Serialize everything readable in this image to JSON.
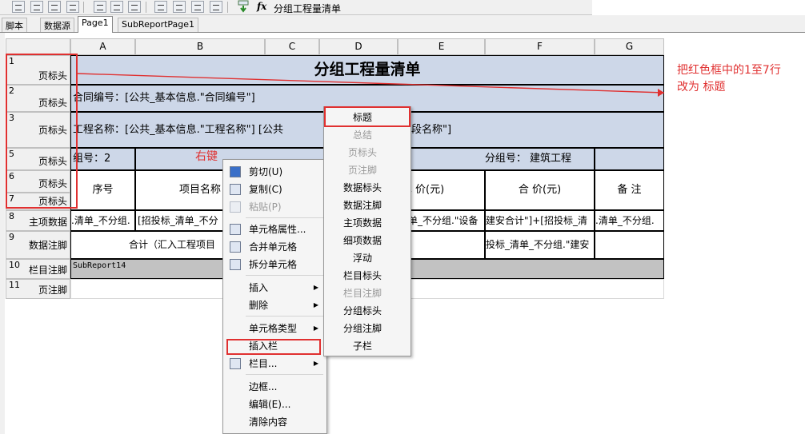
{
  "toolbar": {
    "formula_text": "分组工程量清单"
  },
  "tabs": [
    "脚本",
    "数据源",
    "Page1",
    "SubReportPage1"
  ],
  "columns": [
    "A",
    "B",
    "C",
    "D",
    "E",
    "F",
    "G"
  ],
  "rows": [
    {
      "num": "1",
      "label": "页标头"
    },
    {
      "num": "2",
      "label": "页标头"
    },
    {
      "num": "3",
      "label": "页标头"
    },
    {
      "num": "5",
      "label": "页标头"
    },
    {
      "num": "6",
      "label": "页标头"
    },
    {
      "num": "7",
      "label": "页标头"
    },
    {
      "num": "8",
      "label": "主项数据"
    },
    {
      "num": "9",
      "label": "数据注脚"
    },
    {
      "num": "10",
      "label": "栏目注脚"
    },
    {
      "num": "11",
      "label": "页注脚"
    }
  ],
  "cells": {
    "title": "分组工程量清单",
    "contract": "合同编号：[公共_基本信息.\"合同编号\"]",
    "project": "工程名称：[公共_基本信息.\"工程名称\"] [公共",
    "project_tail": "段名称\"]",
    "group_no": "组号：2",
    "group_name": "分组号： 建筑工程",
    "hdr_no": "序号",
    "hdr_item": "项目名称",
    "hdr_price": "单 价(元)",
    "hdr_total": "合 价(元)",
    "hdr_note": "备 注",
    "r8_a": ".清单_不分组.",
    "r8_b": "[招投标_清单_不分",
    "r8_e": "单_不分组.\"设备",
    "r8_f": "建安合计\"]+[招投标_清",
    "r8_g": ".清单_不分组.",
    "r9_ab": "合计（汇入工程项目",
    "r9_f": "投标_清单_不分组.\"建安",
    "r10": "SubReport14"
  },
  "annotation_right_click": "右键",
  "annotation_note": [
    "把红色框中的1至7行",
    "改为  标题"
  ],
  "context_menu": [
    {
      "label": "剪切(U)",
      "icon": "cut-icon"
    },
    {
      "label": "复制(C)",
      "icon": "copy-icon"
    },
    {
      "label": "粘贴(P)",
      "icon": "paste-icon",
      "disabled": true
    },
    {
      "label": "单元格属性...",
      "icon": "cell-props-icon"
    },
    {
      "label": "合并单元格",
      "icon": "merge-cells-icon"
    },
    {
      "label": "拆分单元格",
      "icon": "split-cells-icon"
    },
    {
      "label": "插入",
      "submenu": true
    },
    {
      "label": "删除",
      "submenu": true
    },
    {
      "label": "单元格类型",
      "submenu": true
    },
    {
      "label": "插入栏"
    },
    {
      "label": "栏目...",
      "icon": "column-icon",
      "submenu": true
    },
    {
      "label": "边框..."
    },
    {
      "label": "编辑(E)..."
    },
    {
      "label": "清除内容"
    }
  ],
  "submenu": [
    {
      "label": "标题"
    },
    {
      "label": "总结",
      "disabled": true
    },
    {
      "label": "页标头",
      "disabled": true
    },
    {
      "label": "页注脚",
      "disabled": true
    },
    {
      "label": "数据标头"
    },
    {
      "label": "数据注脚"
    },
    {
      "label": "主项数据"
    },
    {
      "label": "细项数据"
    },
    {
      "label": "浮动"
    },
    {
      "label": "栏目标头"
    },
    {
      "label": "栏目注脚",
      "disabled": true
    },
    {
      "label": "分组标头"
    },
    {
      "label": "分组注脚"
    },
    {
      "label": "子栏"
    }
  ]
}
